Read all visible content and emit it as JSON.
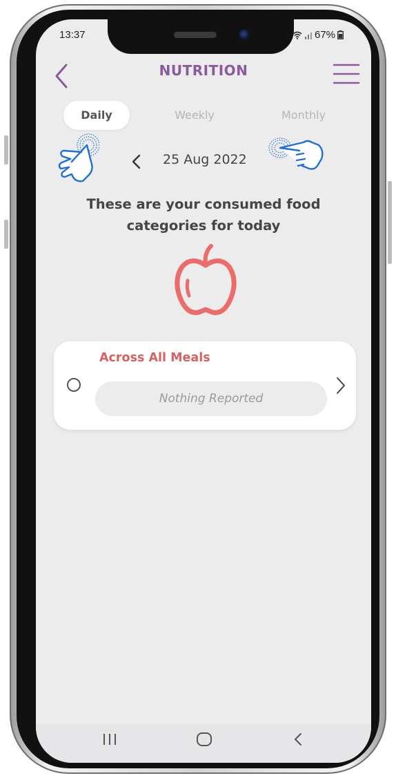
{
  "status_bar": {
    "time": "13:37",
    "battery": "67%",
    "wifi_icon": "wifi-icon",
    "signal_icon": "signal-icon",
    "battery_icon": "battery-icon"
  },
  "header": {
    "title": "NUTRITION",
    "back_icon": "back-arrow-icon",
    "menu_icon": "hamburger-menu-icon"
  },
  "tabs": [
    {
      "label": "Daily",
      "active": true
    },
    {
      "label": "Weekly",
      "active": false
    },
    {
      "label": "Monthly",
      "active": false
    }
  ],
  "date_nav": {
    "date": "25 Aug 2022",
    "prev_icon": "chevron-left-icon"
  },
  "headline": {
    "line1": "These are your consumed food",
    "line2": "categories for today"
  },
  "apple_icon": "apple-icon",
  "card": {
    "title": "Across All Meals",
    "placeholder": "Nothing Reported",
    "radio_icon": "radio-button-icon",
    "chevron_icon": "chevron-right-icon"
  },
  "nav_bar": {
    "recents_icon": "recents-icon",
    "home_icon": "home-icon",
    "back_icon": "nav-back-icon"
  },
  "colors": {
    "title_purple": "#8a5a9a",
    "card_title_red": "#d9615f",
    "apple_red": "#ec6b6b",
    "hand_blue": "#1f6fd6",
    "screen_bg": "#ececed"
  }
}
